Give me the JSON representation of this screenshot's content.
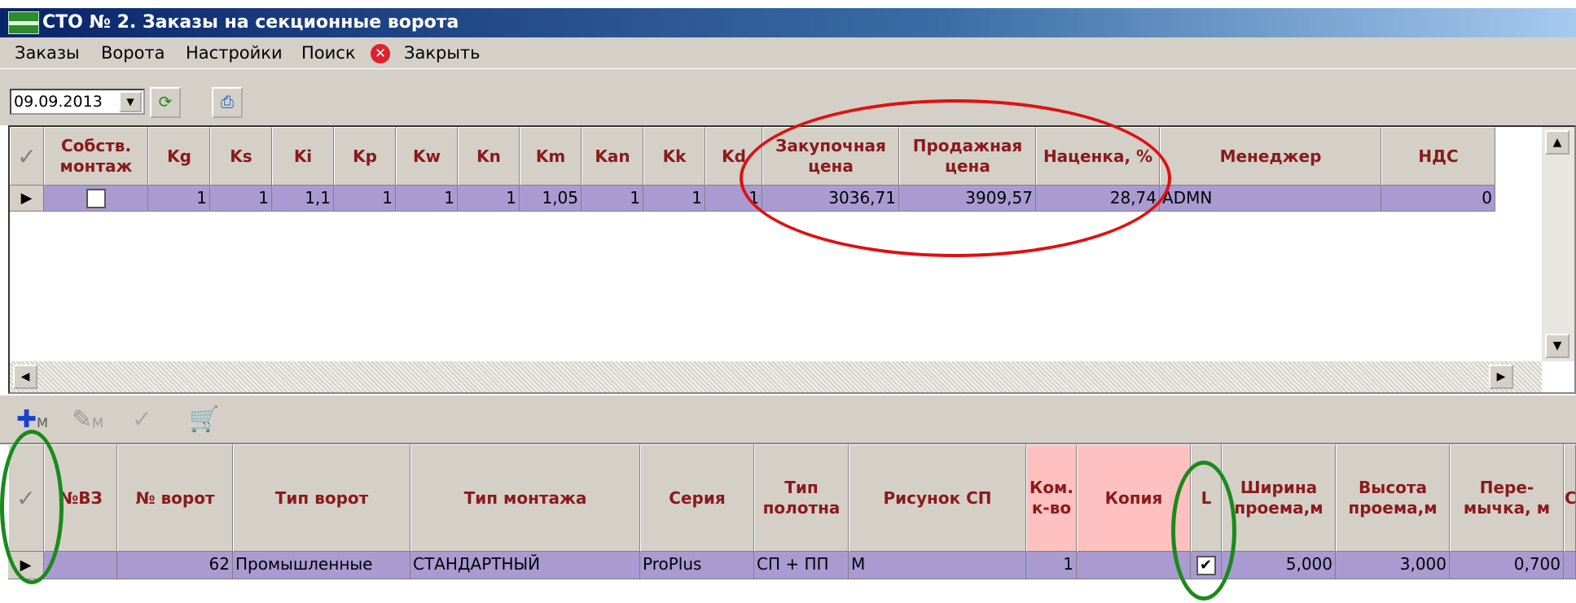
{
  "window": {
    "title": "СТО № 2. Заказы на секционные ворота"
  },
  "menu": {
    "orders": "Заказы",
    "gates": "Ворота",
    "settings": "Настройки",
    "search": "Поиск",
    "close": "Закрыть"
  },
  "toolbar": {
    "date": "09.09.2013"
  },
  "grid1": {
    "headers": {
      "own_install": "Собств. монтаж",
      "kg": "Kg",
      "ks": "Ks",
      "ki": "Ki",
      "kp": "Kp",
      "kw": "Kw",
      "kn": "Kn",
      "km": "Km",
      "kan": "Kan",
      "kk": "Kk",
      "kd": "Kd",
      "purchase_price": "Закупочная цена",
      "sale_price": "Продажная цена",
      "markup": "Наценка, %",
      "manager": "Менеджер",
      "vat": "НДС"
    },
    "row": {
      "own_install": false,
      "kg": "1",
      "ks": "1",
      "ki": "1,1",
      "kp": "1",
      "kw": "1",
      "kn": "1",
      "km": "1,05",
      "kan": "1",
      "kk": "1",
      "kd": "1",
      "purchase_price": "3036,71",
      "sale_price": "3909,57",
      "markup": "28,74",
      "manager": "ADMN",
      "vat": "0"
    }
  },
  "grid2_toolbar": {
    "add_label": "M",
    "edit_label": "M"
  },
  "grid2": {
    "headers": {
      "nvz": "№ВЗ",
      "gate_no": "№ ворот",
      "gate_type": "Тип ворот",
      "install_type": "Тип монтажа",
      "series": "Серия",
      "panel_type": "Тип полотна",
      "panel_pattern": "Рисунок СП",
      "kit_qty": "Ком. к-во",
      "copy": "Копия",
      "l": "L",
      "width": "Ширина проема,м",
      "height": "Высота проема,м",
      "lintel": "Пере- мычка, м",
      "next": "С"
    },
    "row": {
      "nvz": "",
      "gate_no": "62",
      "gate_type": "Промышленные",
      "install_type": "СТАНДАРТНЫЙ",
      "series": "ProPlus",
      "panel_type": "СП + ПП",
      "panel_pattern": "M",
      "kit_qty": "1",
      "copy": "",
      "l": true,
      "width": "5,000",
      "height": "3,000",
      "lintel": "0,700"
    }
  },
  "colors": {
    "header_text": "#8b1a1a",
    "selected_row": "#a99bd2",
    "pink_header": "#ffc0c0",
    "annotation_red": "#e01010",
    "annotation_green": "#1a8a1a"
  }
}
